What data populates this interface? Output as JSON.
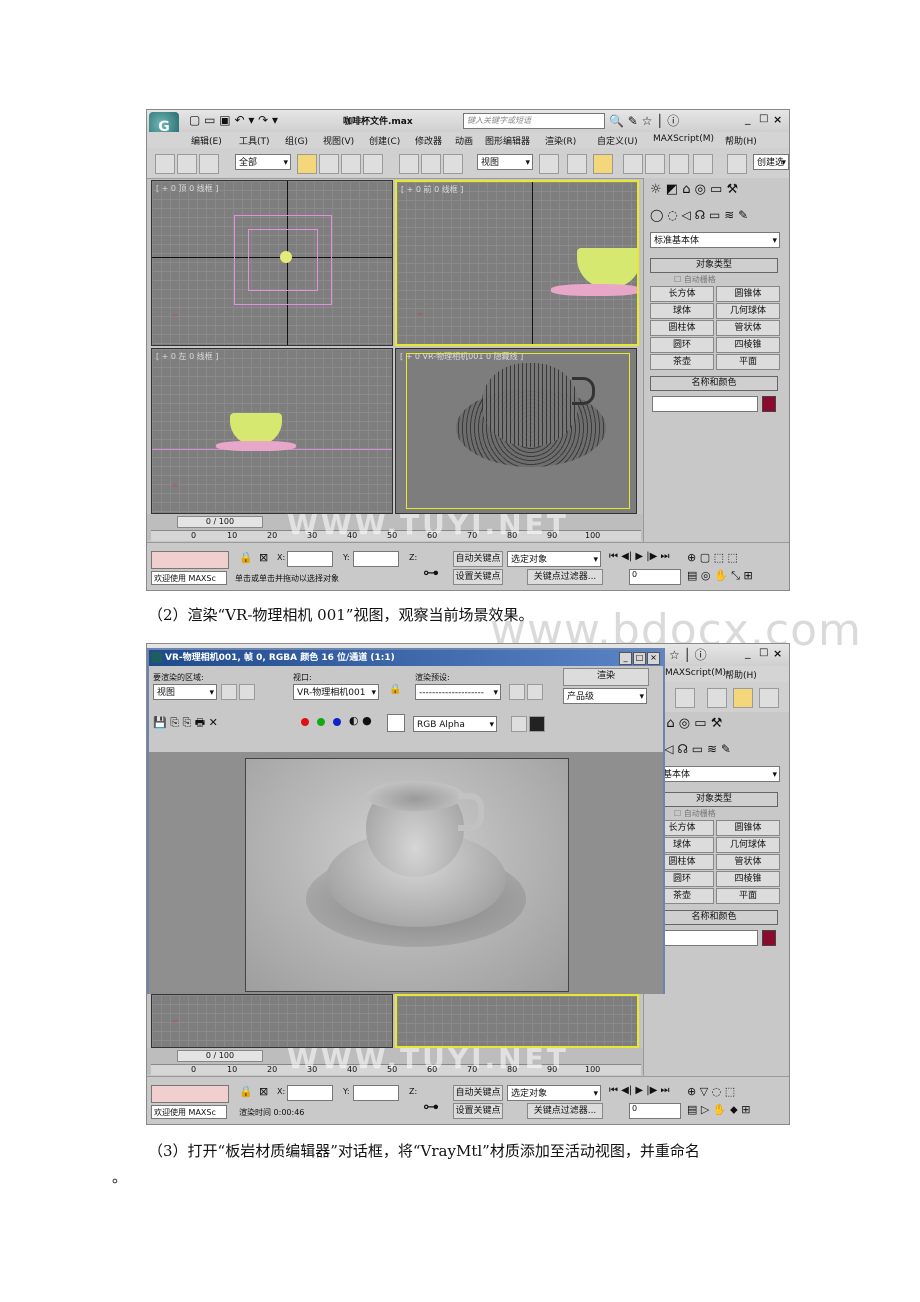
{
  "screenshot1": {
    "logo": "G",
    "title": "咖啡杯文件.max",
    "search_placeholder": "键入关键字或短语",
    "window_controls": [
      "_",
      "□",
      "×"
    ],
    "menu": [
      "编辑(E)",
      "工具(T)",
      "组(G)",
      "视图(V)",
      "创建(C)",
      "修改器",
      "动画",
      "图形编辑器",
      "渲染(R)",
      "自定义(U)",
      "MAXScript(M)",
      "帮助(H)"
    ],
    "selection_filter": "全部",
    "ref_coord": "视图",
    "named_selection": "创建选",
    "viewports": {
      "top": "[ + 0 顶 0 线框 ]",
      "front": "[ + 0 前 0 线框 ]",
      "left": "[ + 0 左 0 线框 ]",
      "persp": "[ + 0 VR-物理相机001 0 隐藏线 ]"
    },
    "command_panel": {
      "category": "标准基本体",
      "object_type_title": "对象类型",
      "autogrid": "自动栅格",
      "buttons": [
        "长方体",
        "圆锥体",
        "球体",
        "几何球体",
        "圆柱体",
        "管状体",
        "圆环",
        "四棱锥",
        "茶壶",
        "平面"
      ],
      "name_color_title": "名称和颜色",
      "color": "#8b0a2e"
    },
    "timeline": {
      "frame": "0 / 100",
      "ticks": [
        "0",
        "10",
        "20",
        "30",
        "40",
        "50",
        "60",
        "70",
        "80",
        "90",
        "100"
      ]
    },
    "status": {
      "welcome": "欢迎使用 MAXSc",
      "prompt": "单击或单击并拖动以选择对象",
      "x_label": "X:",
      "y_label": "Y:",
      "z_label": "Z:",
      "auto_key": "自动关键点",
      "set_key": "设置关键点",
      "selected": "选定对象",
      "key_filters": "关键点过滤器...",
      "frame_value": "0"
    },
    "watermark": "WWW.TUYI.NET"
  },
  "caption2": "（2）渲染“VR-物理相机 001”视图，观察当前场景效果。",
  "page_watermark": "www.bdocx.com",
  "screenshot2": {
    "render_window": {
      "title": "VR-物理相机001, 帧 0, RGBA 颜色 16 位/通道 (1:1)",
      "area_label": "要渲染的区域:",
      "area_value": "视图",
      "viewport_label": "视口:",
      "viewport_value": "VR-物理相机001",
      "preset_label": "渲染预设:",
      "preset_value": "--------------------",
      "render_button": "渲染",
      "product_value": "产品级",
      "channel_value": "RGB Alpha"
    },
    "menu_right": [
      "MAXScript(M)",
      "帮助(H)"
    ],
    "command_panel": {
      "category": "准基本体",
      "object_type_title": "对象类型",
      "autogrid": "自动栅格",
      "buttons": [
        "长方体",
        "圆锥体",
        "球体",
        "几何球体",
        "圆柱体",
        "管状体",
        "圆环",
        "四棱锥",
        "茶壶",
        "平面"
      ],
      "name_color_title": "名称和颜色",
      "color": "#8b0a2e"
    },
    "timeline": {
      "frame": "0 / 100",
      "ticks": [
        "0",
        "10",
        "20",
        "30",
        "40",
        "50",
        "60",
        "70",
        "80",
        "90",
        "100"
      ]
    },
    "status": {
      "welcome": "欢迎使用 MAXSc",
      "prompt": "渲染时间  0:00:46",
      "x_label": "X:",
      "y_label": "Y:",
      "z_label": "Z:",
      "auto_key": "自动关键点",
      "set_key": "设置关键点",
      "selected": "选定对象",
      "key_filters": "关键点过滤器...",
      "frame_value": "0"
    },
    "watermark": "WWW.TUYI.NET"
  },
  "caption3_line1": "（3）打开“板岩材质编辑器”对话框，将“VrayMtl”材质添加至活动视图，并重命名",
  "caption3_line2": "。"
}
